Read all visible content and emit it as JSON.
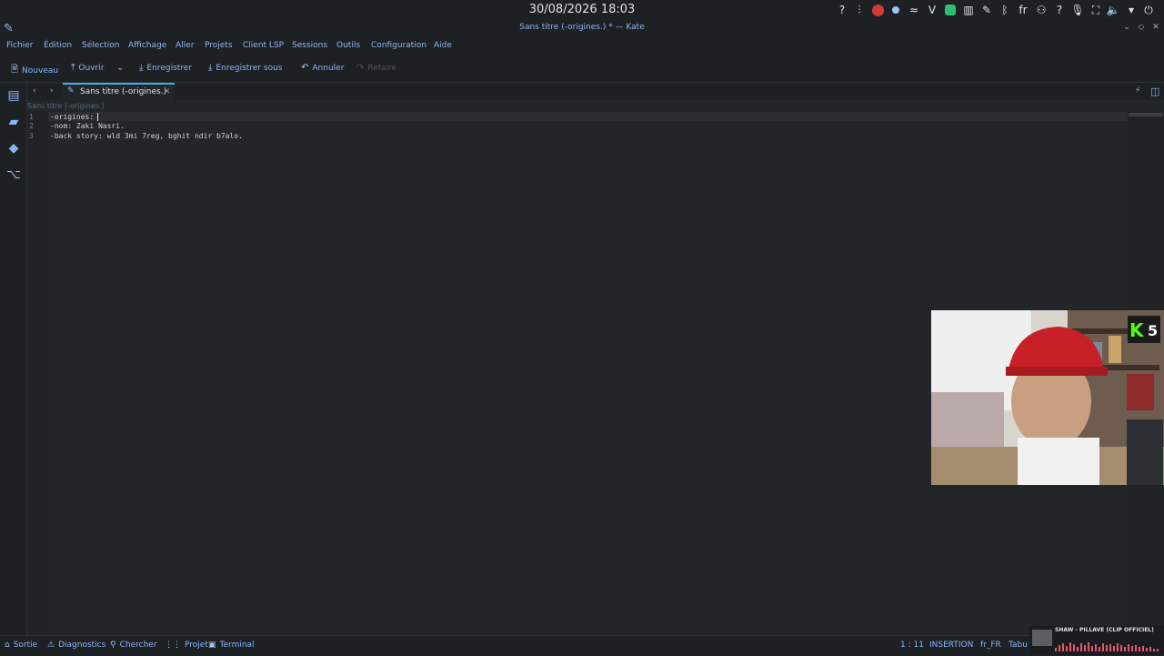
{
  "clock": "30/08/2026 18:03",
  "window_title": "Sans titre (-origines.) * — Kate",
  "menu": [
    "Fichier",
    "Édition",
    "Sélection",
    "Affichage",
    "Aller",
    "Projets",
    "Client LSP",
    "Sessions",
    "Outils",
    "Configuration",
    "Aide"
  ],
  "toolbar": {
    "new": "Nouveau",
    "open": "Ouvrir",
    "save": "Enregistrer",
    "save_as": "Enregistrer sous",
    "undo": "Annuler",
    "redo": "Refaire"
  },
  "tab": {
    "label": "Sans titre (-origines.)"
  },
  "breadcrumb": "Sans titre (-origines.)",
  "editor": {
    "lines": [
      {
        "num": "1",
        "text": "-origines:"
      },
      {
        "num": "2",
        "text": "-nom: Zaki Nasri."
      },
      {
        "num": "3",
        "text": "-back story: wld 3mi 7reg, bghit ndir b7alo."
      }
    ]
  },
  "tray": {
    "lang": "fr"
  },
  "webcam": {
    "badge_letter": "K",
    "badge_count": "5"
  },
  "status": {
    "output": "Sortie",
    "diagnostics": "Diagnostics",
    "search": "Chercher",
    "project": "Projet",
    "terminal": "Terminal",
    "position": "1 : 11",
    "mode": "INSERTION",
    "dictionary": "fr_FR",
    "indent": "Tabu"
  },
  "music": {
    "title": "SHAW - PILLAVE (CLIP OFFICIEL)"
  },
  "colors": {
    "accent": "#3daee9",
    "text_link": "#8ab4f8",
    "background": "#232629"
  }
}
